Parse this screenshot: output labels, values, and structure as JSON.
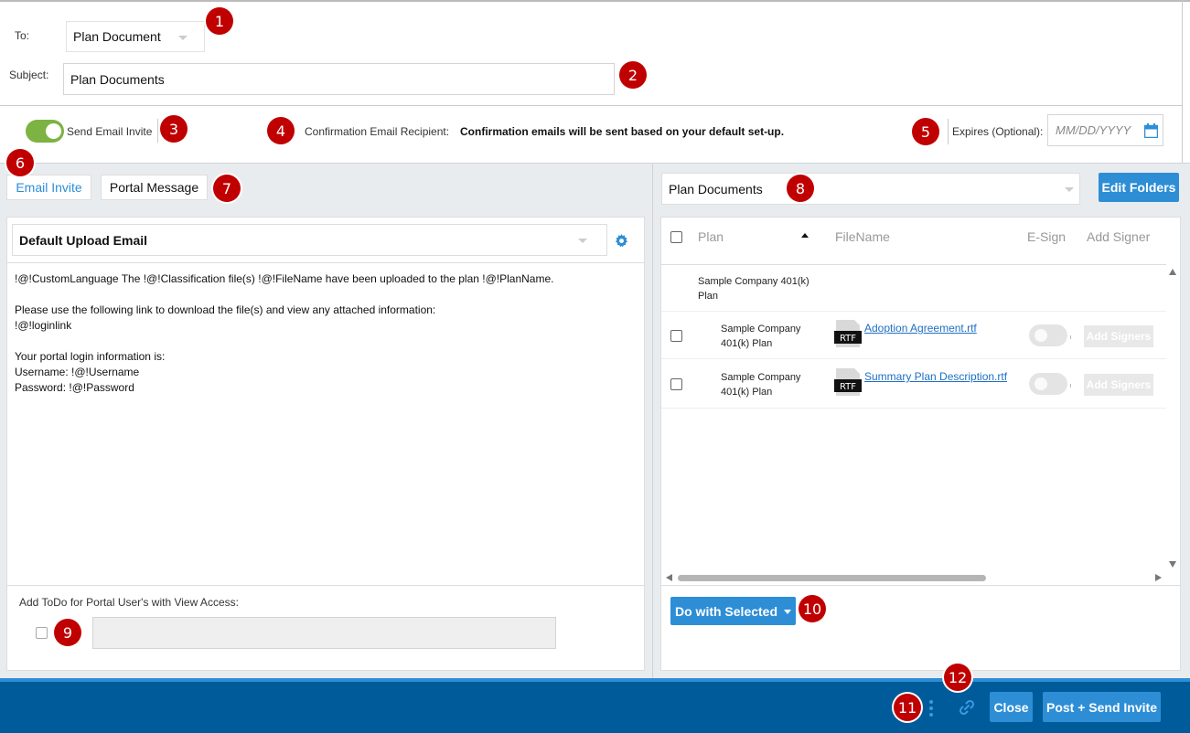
{
  "header": {
    "to_label": "To:",
    "to_value": "Plan Document",
    "subject_label": "Subject:",
    "subject_value": "Plan Documents"
  },
  "options": {
    "send_email_invite_label": "Send Email Invite",
    "send_email_invite_on": true,
    "confirmation_label": "Confirmation Email Recipient:",
    "confirmation_value": "Confirmation emails will be sent based on your default set-up.",
    "expires_label": "Expires (Optional):",
    "expires_placeholder": "MM/DD/YYYY"
  },
  "tabs": [
    {
      "label": "Email Invite",
      "active": true
    },
    {
      "label": "Portal Message",
      "active": false
    }
  ],
  "email": {
    "template_value": "Default Upload Email",
    "body_lines": [
      "!@!CustomLanguage The !@!Classification file(s) !@!FileName have been uploaded to the plan !@!PlanName.",
      "",
      "Please use the following link to download the file(s) and view any attached information:",
      "!@!loginlink",
      "",
      "Your portal login information is:",
      "Username: !@!Username",
      "Password: !@!Password"
    ],
    "todo_label": "Add ToDo for Portal User's with View Access:"
  },
  "documents": {
    "folder_value": "Plan Documents",
    "edit_folders_label": "Edit Folders",
    "columns": [
      "Plan",
      "FileName",
      "E-Sign",
      "Add Signer"
    ],
    "group_label": "Sample Company 401(k) Plan",
    "rows": [
      {
        "plan": "Sample Company 401(k) Plan",
        "file_type": "RTF",
        "file_name": "Adoption Agreement.rtf",
        "add_signers_label": "Add Signers"
      },
      {
        "plan": "Sample Company 401(k) Plan",
        "file_type": "RTF",
        "file_name": "Summary Plan Description.rtf",
        "add_signers_label": "Add Signers"
      }
    ],
    "do_with_selected_label": "Do with Selected"
  },
  "footer": {
    "close_label": "Close",
    "post_send_label": "Post + Send Invite"
  },
  "callouts": [
    "1",
    "2",
    "3",
    "4",
    "5",
    "6",
    "7",
    "8",
    "9",
    "10",
    "11",
    "12"
  ],
  "colors": {
    "accent_blue": "#2d8ed6",
    "footer_blue": "#005b9a",
    "toggle_green": "#7cb342",
    "callout_red": "#c00000"
  }
}
